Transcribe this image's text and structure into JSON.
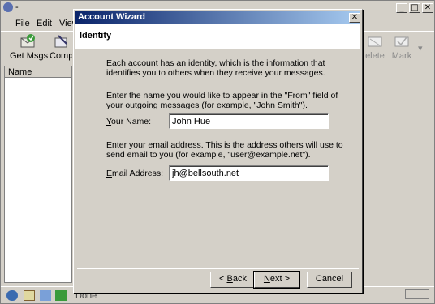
{
  "app": {
    "title": "-",
    "menu": [
      "File",
      "Edit",
      "View"
    ],
    "toolbar": {
      "get_msgs": "Get Msgs",
      "compose": "Compo",
      "delete": "elete",
      "mark": "Mark"
    },
    "folder_pane": {
      "header": "Name"
    },
    "status_text": "Done"
  },
  "dialog": {
    "title": "Account Wizard",
    "close_glyph": "✕",
    "page_title": "Identity",
    "intro": "Each account has an identity, which is the information that identifies you to others when they receive your messages.",
    "name_help": "Enter the name you would like to appear in the \"From\" field of your outgoing messages (for example, \"John Smith\").",
    "name_label": "Your Name:",
    "name_value": "John Hue",
    "email_help": "Enter your email address. This is the address others will use to send email to you (for example, \"user@example.net\").",
    "email_label": "Email Address:",
    "email_value": "jh@bellsouth.net",
    "buttons": {
      "back": "< Back",
      "next": "Next >",
      "cancel": "Cancel"
    }
  },
  "colors": {
    "dialog_title_start": "#0a246a",
    "dialog_title_end": "#a6caf0",
    "chrome": "#d4d0c8"
  },
  "icons": [
    "app-logo-icon",
    "get-msgs-icon",
    "compose-icon",
    "delete-icon",
    "mark-icon",
    "mail-icon",
    "address-book-icon",
    "composer-icon",
    "chat-icon",
    "progress-icon"
  ]
}
